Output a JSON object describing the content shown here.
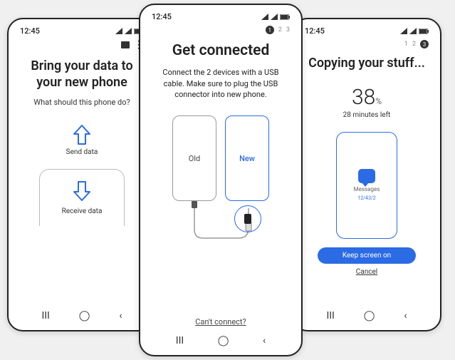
{
  "status": {
    "time": "12:45"
  },
  "left": {
    "title_line1": "Bring your data to",
    "title_line2": "your new phone",
    "subtitle": "What should this phone do?",
    "send_label": "Send data",
    "receive_label": "Receive data"
  },
  "center": {
    "steps": [
      "1",
      "2",
      "3"
    ],
    "title": "Get connected",
    "body": "Connect the 2 devices with a USB cable. Make sure to plug the USB connector into new phone.",
    "old_label": "Old",
    "new_label": "New",
    "cant_connect": "Can't connect?"
  },
  "right": {
    "steps": [
      "1",
      "2",
      "3"
    ],
    "title": "Copying your stuff...",
    "percent": "38",
    "percent_sym": "%",
    "eta": "28 minutes left",
    "item_label": "Messages",
    "item_count": "12/43/2",
    "keep_on": "Keep screen on",
    "cancel": "Cancel"
  },
  "nav": {
    "recent": "III",
    "home": "◯",
    "back": "‹"
  }
}
